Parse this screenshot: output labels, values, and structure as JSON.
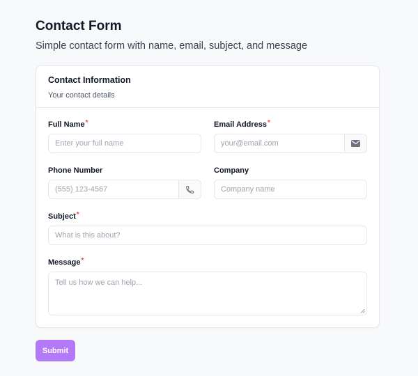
{
  "page": {
    "title": "Contact Form",
    "subtitle": "Simple contact form with name, email, subject, and message"
  },
  "card": {
    "title": "Contact Information",
    "description": "Your contact details"
  },
  "fields": {
    "full_name": {
      "label": "Full Name",
      "required": "*",
      "placeholder": "Enter your full name"
    },
    "email": {
      "label": "Email Address",
      "required": "*",
      "placeholder": "your@email.com",
      "icon": "mail-icon"
    },
    "phone": {
      "label": "Phone Number",
      "placeholder": "(555) 123-4567",
      "icon": "phone-icon"
    },
    "company": {
      "label": "Company",
      "placeholder": "Company name"
    },
    "subject": {
      "label": "Subject",
      "required": "*",
      "placeholder": "What is this about?"
    },
    "message": {
      "label": "Message",
      "required": "*",
      "placeholder": "Tell us how we can help..."
    }
  },
  "submit": {
    "label": "Submit"
  },
  "colors": {
    "accent": "#b37af7",
    "required": "#ef4444",
    "border": "#e5e7eb",
    "background": "#f8f9fb"
  }
}
